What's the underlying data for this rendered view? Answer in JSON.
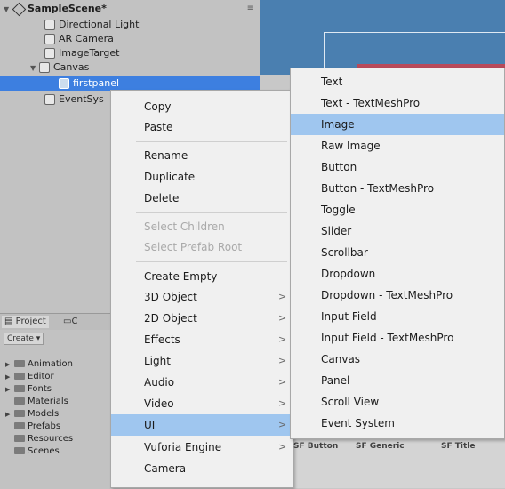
{
  "hierarchy": {
    "scene_name": "SampleScene*",
    "menu_glyph": "≡",
    "items": [
      {
        "label": "Directional Light"
      },
      {
        "label": "AR Camera"
      },
      {
        "label": "ImageTarget"
      },
      {
        "label": "Canvas"
      },
      {
        "label": "firstpanel"
      },
      {
        "label": "EventSys"
      }
    ]
  },
  "project": {
    "tab_project": "Project",
    "tab_console": "C",
    "create_label": "Create",
    "folders": [
      {
        "label": "Animation",
        "expandable": true
      },
      {
        "label": "Editor",
        "expandable": true
      },
      {
        "label": "Fonts",
        "expandable": true
      },
      {
        "label": "Materials",
        "expandable": false
      },
      {
        "label": "Models",
        "expandable": true
      },
      {
        "label": "Prefabs",
        "expandable": false
      },
      {
        "label": "Resources",
        "expandable": false
      },
      {
        "label": "Scenes",
        "expandable": false
      }
    ]
  },
  "bottom_strip": {
    "labels": [
      "SF Button",
      "SF Generic",
      "SF Title"
    ]
  },
  "context_menu": {
    "items": [
      {
        "label": "Copy"
      },
      {
        "label": "Paste"
      },
      {
        "label": "Rename"
      },
      {
        "label": "Duplicate"
      },
      {
        "label": "Delete"
      },
      {
        "label": "Select Children",
        "disabled": true
      },
      {
        "label": "Select Prefab Root",
        "disabled": true
      },
      {
        "label": "Create Empty"
      },
      {
        "label": "3D Object",
        "submenu": true
      },
      {
        "label": "2D Object",
        "submenu": true
      },
      {
        "label": "Effects",
        "submenu": true
      },
      {
        "label": "Light",
        "submenu": true
      },
      {
        "label": "Audio",
        "submenu": true
      },
      {
        "label": "Video",
        "submenu": true
      },
      {
        "label": "UI",
        "submenu": true,
        "active": true
      },
      {
        "label": "Vuforia Engine",
        "submenu": true
      },
      {
        "label": "Camera"
      }
    ],
    "arrow_glyph": ">"
  },
  "ui_submenu": {
    "items": [
      {
        "label": "Text"
      },
      {
        "label": "Text - TextMeshPro"
      },
      {
        "label": "Image",
        "active": true
      },
      {
        "label": "Raw Image"
      },
      {
        "label": "Button"
      },
      {
        "label": "Button - TextMeshPro"
      },
      {
        "label": "Toggle"
      },
      {
        "label": "Slider"
      },
      {
        "label": "Scrollbar"
      },
      {
        "label": "Dropdown"
      },
      {
        "label": "Dropdown - TextMeshPro"
      },
      {
        "label": "Input Field"
      },
      {
        "label": "Input Field - TextMeshPro"
      },
      {
        "label": "Canvas"
      },
      {
        "label": "Panel"
      },
      {
        "label": "Scroll View"
      },
      {
        "label": "Event System"
      }
    ]
  },
  "colors": {
    "selection": "#3d7fe0",
    "menu_highlight": "#9fc6ef",
    "scene_bg": "#4a7fb0"
  }
}
